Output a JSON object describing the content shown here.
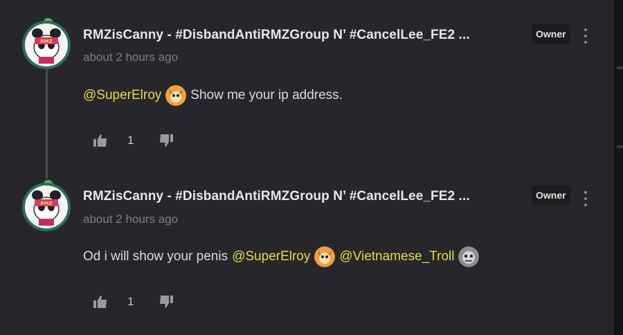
{
  "comments": [
    {
      "author": "RMZisCanny - #DisbandAntiRMZGroup N’ #CancelLee_FE2 ...",
      "timestamp": "about 2 hours ago",
      "badge": "Owner",
      "body": [
        {
          "type": "mention",
          "text": "@SuperElroy"
        },
        {
          "type": "avatar",
          "icon": "orange-fox-avatar"
        },
        {
          "type": "text",
          "text": "Show me your ip address."
        }
      ],
      "upvotes": "1"
    },
    {
      "author": "RMZisCanny - #DisbandAntiRMZGroup N’ #CancelLee_FE2 ...",
      "timestamp": "about 2 hours ago",
      "badge": "Owner",
      "body": [
        {
          "type": "text",
          "text": "Od i will show your penis"
        },
        {
          "type": "mention",
          "text": "@SuperElroy"
        },
        {
          "type": "avatar",
          "icon": "orange-fox-avatar"
        },
        {
          "type": "mention",
          "text": "@Vietnamese_Troll"
        },
        {
          "type": "avatar",
          "icon": "gray-troll-avatar"
        }
      ],
      "upvotes": "1"
    }
  ],
  "colors": {
    "panel": "#27272b",
    "mention": "#e9d94a",
    "text": "#dcdcdf",
    "timestamp": "#7d7d83"
  },
  "icons": [
    "thumbs-up-icon",
    "thumbs-down-icon",
    "more-options-icon"
  ]
}
